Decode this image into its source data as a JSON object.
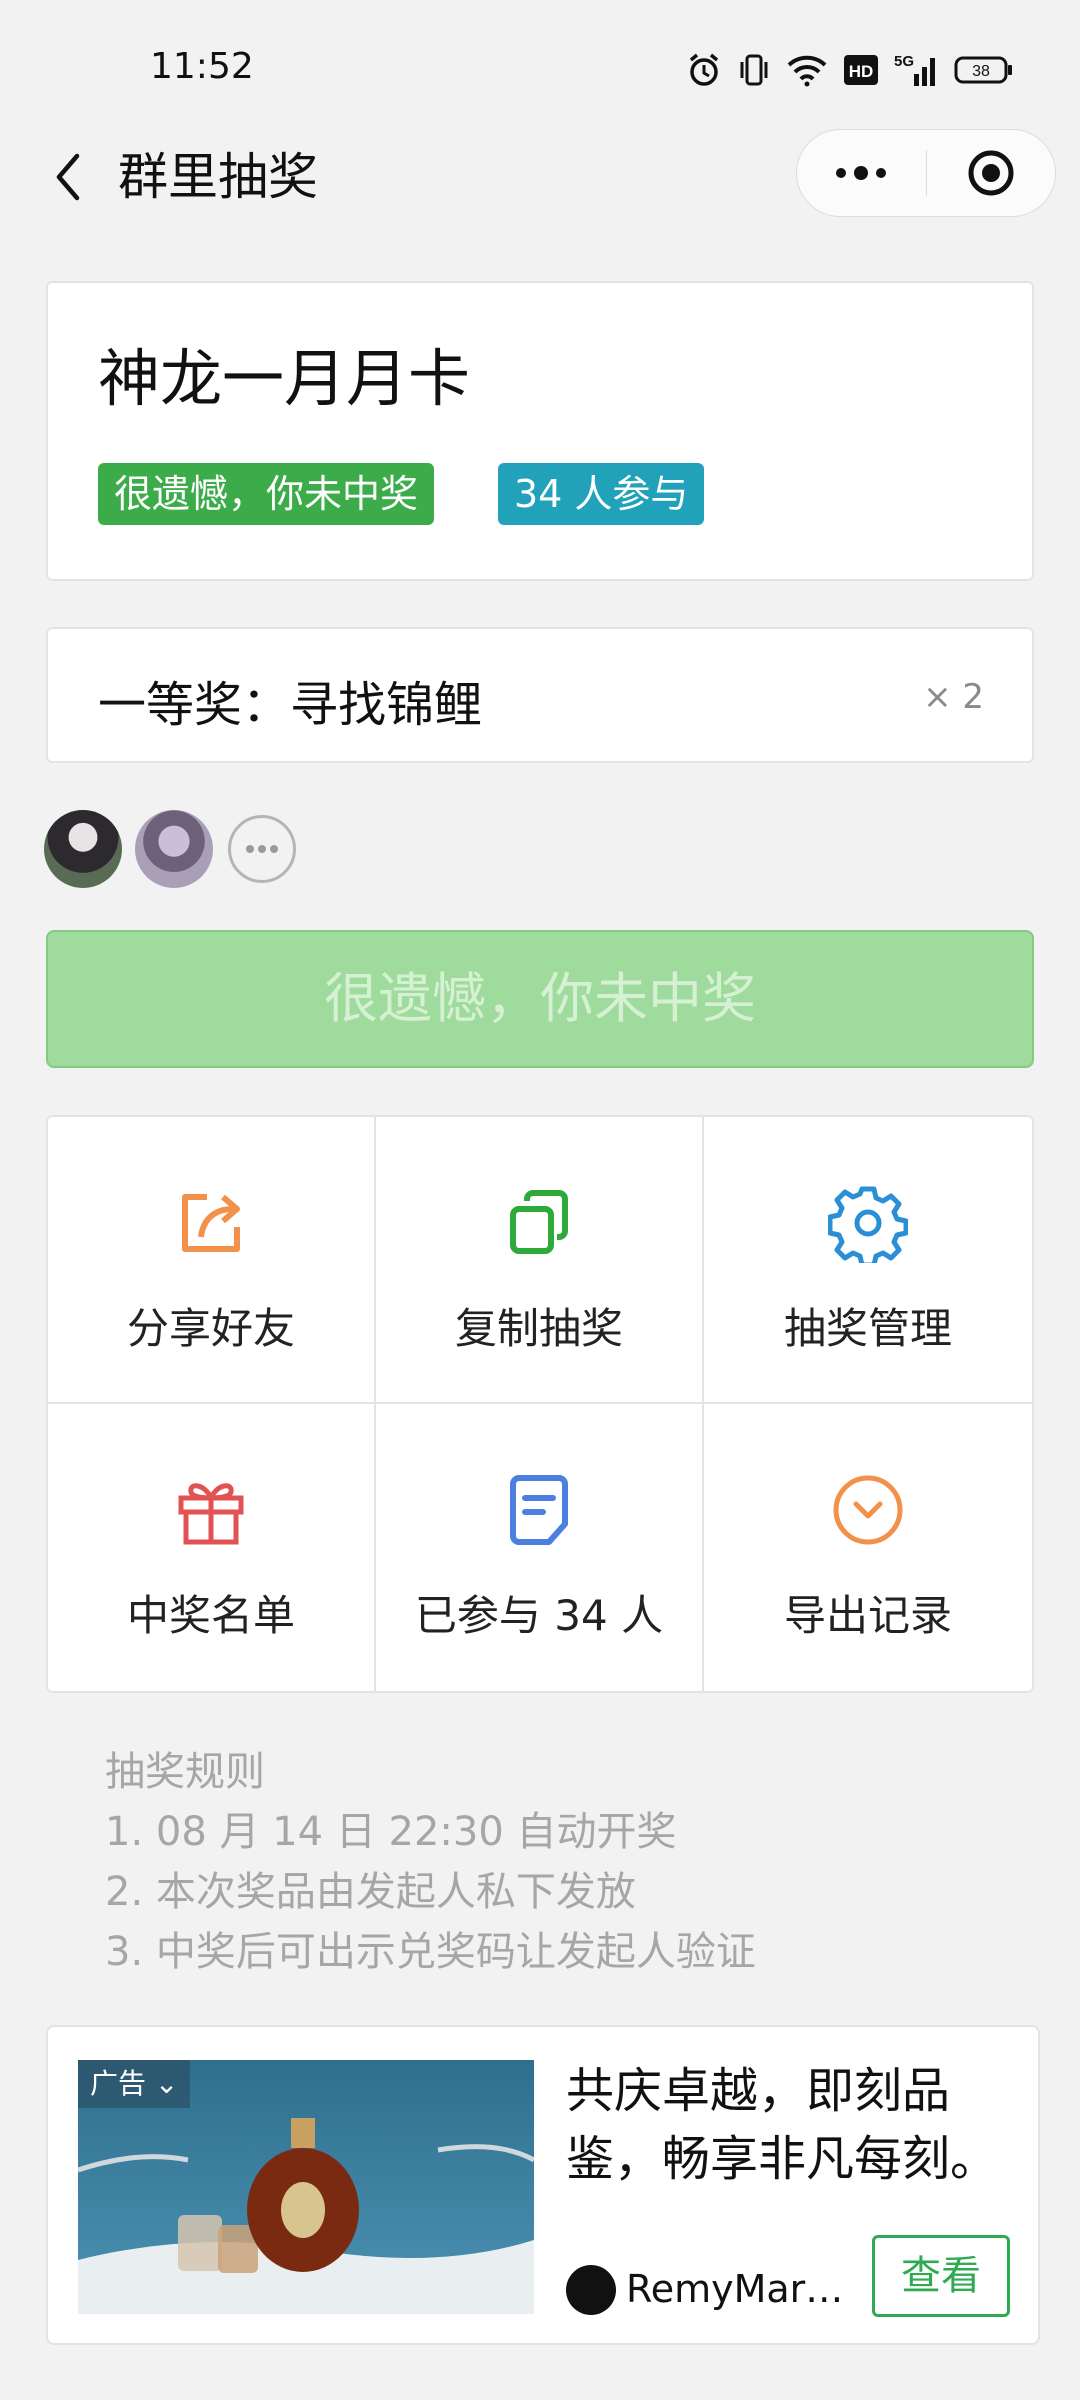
{
  "status_bar": {
    "time": "11:52",
    "battery": "38",
    "icons": [
      "alarm-icon",
      "vibrate-icon",
      "wifi-icon",
      "hd-icon",
      "5g-signal-icon",
      "battery-icon"
    ]
  },
  "nav": {
    "title": "群里抽奖",
    "icons": [
      "back-arrow-icon",
      "more-dots-icon",
      "target-icon"
    ]
  },
  "lottery": {
    "prize_title": "神龙一月月卡",
    "result_tag": "很遗憾，你未中奖",
    "participants_tag": "34 人参与"
  },
  "prize_level": {
    "label": "一等奖：寻找锦鲤",
    "quantity": "× 2"
  },
  "result_button": "很遗憾，你未中奖",
  "actions": [
    {
      "label": "分享好友",
      "icon": "share-icon",
      "color": "#f2914a"
    },
    {
      "label": "复制抽奖",
      "icon": "copy-icon",
      "color": "#2daa3a"
    },
    {
      "label": "抽奖管理",
      "icon": "gear-icon",
      "color": "#2b8fd6"
    },
    {
      "label": "中奖名单",
      "icon": "gift-icon",
      "color": "#e25252"
    },
    {
      "label": "已参与 34 人",
      "icon": "document-icon",
      "color": "#4d7fe0"
    },
    {
      "label": "导出记录",
      "icon": "download-circle-icon",
      "color": "#f2914a"
    }
  ],
  "rules": {
    "title": "抽奖规则",
    "items": [
      "1. 08 月 14 日 22:30 自动开奖",
      "2. 本次奖品由发起人私下发放",
      "3. 中奖后可出示兑奖码让发起人验证"
    ]
  },
  "ad": {
    "badge": "广告",
    "text": "共庆卓越，即刻品鉴，畅享非凡每刻。",
    "brand": "RemyMartin...",
    "button": "查看"
  },
  "colors": {
    "accent_green": "#3cac4a",
    "accent_teal": "#22a1bb",
    "disabled_green": "#9fdb9c",
    "ad_button": "#2daa52"
  }
}
